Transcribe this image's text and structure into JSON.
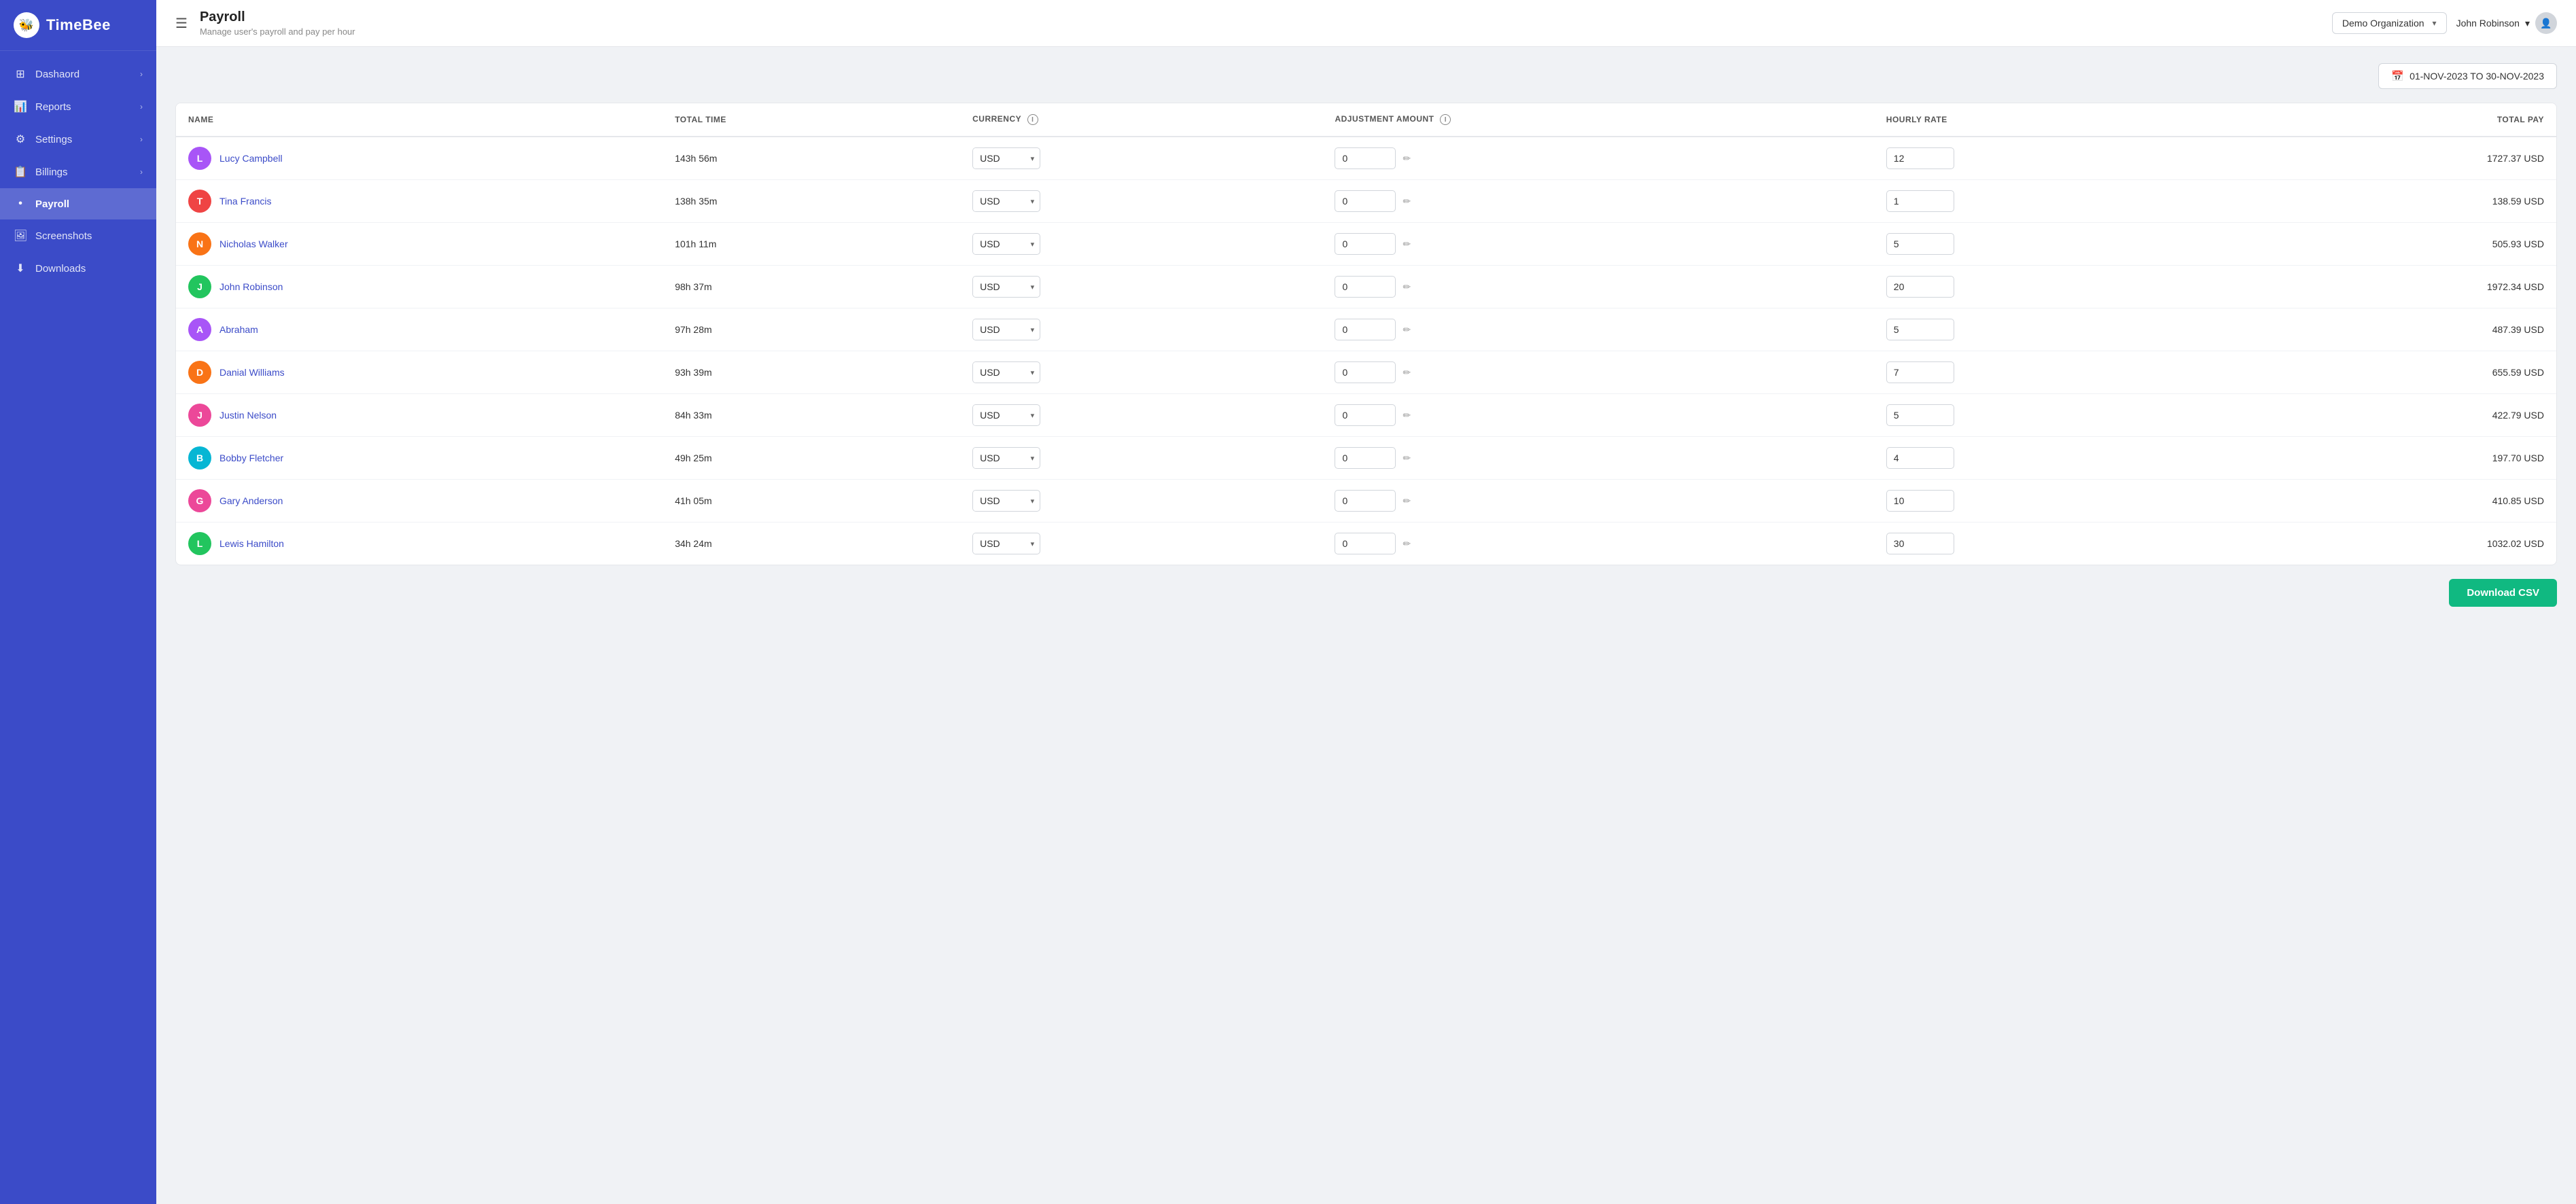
{
  "app": {
    "name": "TimeBee",
    "logo_emoji": "🐝"
  },
  "sidebar": {
    "items": [
      {
        "id": "dashboard",
        "label": "Dashaord",
        "icon": "⊞",
        "hasArrow": true,
        "active": false
      },
      {
        "id": "reports",
        "label": "Reports",
        "icon": "📊",
        "hasArrow": true,
        "active": false
      },
      {
        "id": "settings",
        "label": "Settings",
        "icon": "⚙",
        "hasArrow": true,
        "active": false
      },
      {
        "id": "billings",
        "label": "Billings",
        "icon": "📋",
        "hasArrow": true,
        "active": false
      },
      {
        "id": "payroll",
        "label": "Payroll",
        "icon": "•",
        "hasArrow": false,
        "active": true
      },
      {
        "id": "screenshots",
        "label": "Screenshots",
        "icon": "🖼",
        "hasArrow": false,
        "active": false
      },
      {
        "id": "downloads",
        "label": "Downloads",
        "icon": "⬇",
        "hasArrow": false,
        "active": false
      }
    ]
  },
  "topbar": {
    "hamburger": "☰",
    "title": "Payroll",
    "subtitle": "Manage user's payroll and pay per hour",
    "org": "Demo Organization",
    "user": "John Robinson",
    "chevron": "▾"
  },
  "date_range": {
    "label": "01-NOV-2023 TO 30-NOV-2023"
  },
  "table": {
    "columns": [
      {
        "id": "name",
        "label": "NAME"
      },
      {
        "id": "total_time",
        "label": "TOTAL TIME"
      },
      {
        "id": "currency",
        "label": "CURRENCY",
        "info": true
      },
      {
        "id": "adjustment_amount",
        "label": "ADJUSTMENT AMOUNT",
        "info": true
      },
      {
        "id": "hourly_rate",
        "label": "HOURLY RATE"
      },
      {
        "id": "total_pay",
        "label": "TOTAL PAY",
        "align": "right"
      }
    ],
    "rows": [
      {
        "id": 1,
        "name": "Lucy Campbell",
        "initial": "L",
        "color": "#a855f7",
        "total_time": "143h 56m",
        "currency": "USD",
        "adjustment": "0",
        "hourly_rate": "12",
        "total_pay": "1727.37 USD"
      },
      {
        "id": 2,
        "name": "Tina Francis",
        "initial": "T",
        "color": "#ef4444",
        "total_time": "138h 35m",
        "currency": "USD",
        "adjustment": "0",
        "hourly_rate": "1",
        "total_pay": "138.59 USD"
      },
      {
        "id": 3,
        "name": "Nicholas Walker",
        "initial": "N",
        "color": "#f97316",
        "total_time": "101h 11m",
        "currency": "USD",
        "adjustment": "0",
        "hourly_rate": "5",
        "total_pay": "505.93 USD"
      },
      {
        "id": 4,
        "name": "John Robinson",
        "initial": "J",
        "color": "#22c55e",
        "total_time": "98h 37m",
        "currency": "USD",
        "adjustment": "0",
        "hourly_rate": "20",
        "total_pay": "1972.34 USD"
      },
      {
        "id": 5,
        "name": "Abraham",
        "initial": "A",
        "color": "#a855f7",
        "total_time": "97h 28m",
        "currency": "USD",
        "adjustment": "0",
        "hourly_rate": "5",
        "total_pay": "487.39 USD"
      },
      {
        "id": 6,
        "name": "Danial Williams",
        "initial": "D",
        "color": "#f97316",
        "total_time": "93h 39m",
        "currency": "USD",
        "adjustment": "0",
        "hourly_rate": "7",
        "total_pay": "655.59 USD"
      },
      {
        "id": 7,
        "name": "Justin Nelson",
        "initial": "J",
        "color": "#ec4899",
        "total_time": "84h 33m",
        "currency": "USD",
        "adjustment": "0",
        "hourly_rate": "5",
        "total_pay": "422.79 USD"
      },
      {
        "id": 8,
        "name": "Bobby Fletcher",
        "initial": "B",
        "color": "#06b6d4",
        "total_time": "49h 25m",
        "currency": "USD",
        "adjustment": "0",
        "hourly_rate": "4",
        "total_pay": "197.70 USD"
      },
      {
        "id": 9,
        "name": "Gary Anderson",
        "initial": "G",
        "color": "#ec4899",
        "total_time": "41h 05m",
        "currency": "USD",
        "adjustment": "0",
        "hourly_rate": "10",
        "total_pay": "410.85 USD"
      },
      {
        "id": 10,
        "name": "Lewis Hamilton",
        "initial": "L",
        "color": "#22c55e",
        "total_time": "34h 24m",
        "currency": "USD",
        "adjustment": "0",
        "hourly_rate": "30",
        "total_pay": "1032.02 USD"
      }
    ]
  },
  "buttons": {
    "download_csv": "Download CSV"
  }
}
